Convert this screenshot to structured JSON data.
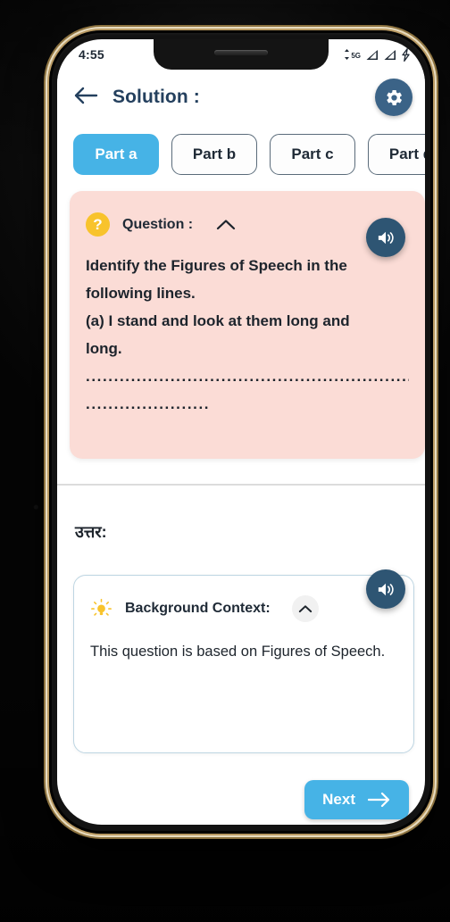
{
  "status_bar": {
    "time": "4:55",
    "network_label": "5G",
    "icons": [
      "network-5g-icon",
      "signal-bars-icon",
      "signal-bars-secondary-icon",
      "battery-charging-icon"
    ]
  },
  "app_bar": {
    "back_icon": "back-arrow-icon",
    "title": "Solution :",
    "settings_icon": "gear-icon"
  },
  "tabs": [
    {
      "label": "Part a",
      "active": true
    },
    {
      "label": "Part b",
      "active": false
    },
    {
      "label": "Part c",
      "active": false
    },
    {
      "label": "Part d",
      "active": false
    }
  ],
  "question_card": {
    "badge_glyph": "?",
    "badge_icon": "question-mark-icon",
    "label": "Question :",
    "collapse_icon": "chevron-up-icon",
    "speaker_icon": "speaker-volume-icon",
    "lines": [
      "Identify the Figures of Speech in the",
      "following lines.",
      "(a) I stand and look at them long and",
      "long."
    ],
    "blank_line_1": "......................................................................",
    "blank_line_2": "......................",
    "background_color": "#fbdcd6"
  },
  "answer_section": {
    "label": "उत्तर:",
    "speaker_icon": "speaker-volume-icon",
    "card": {
      "bulb_icon": "lightbulb-icon",
      "label": "Background Context:",
      "collapse_icon": "chevron-up-icon",
      "body": "This question is based on Figures of Speech."
    }
  },
  "next_button": {
    "label": "Next",
    "arrow_icon": "arrow-right-icon"
  },
  "colors": {
    "accent_blue": "#46b3e6",
    "header_navy": "#24405e",
    "speaker_navy": "#2e5573",
    "gear_navy": "#3b6387",
    "question_pink": "#fbdcd6",
    "badge_yellow": "#f8c32c"
  }
}
